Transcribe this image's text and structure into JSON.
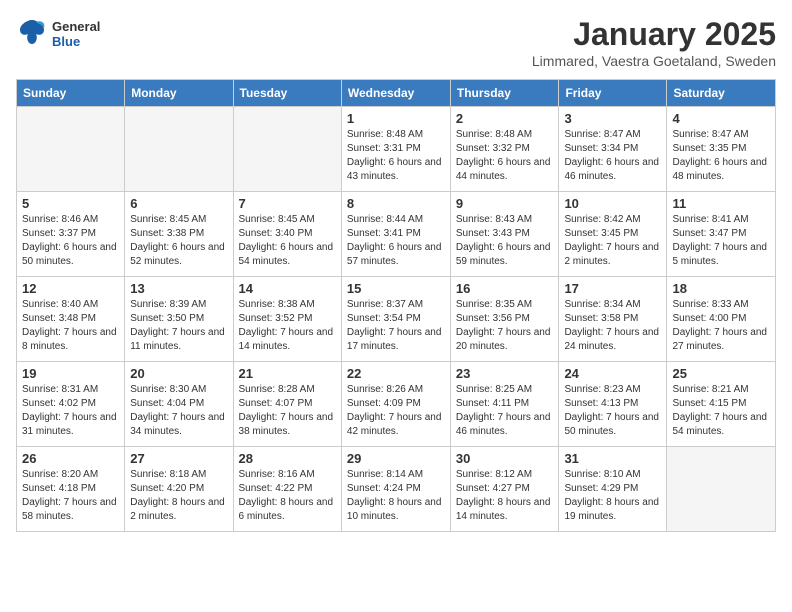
{
  "header": {
    "logo_line1": "General",
    "logo_line2": "Blue",
    "month": "January 2025",
    "location": "Limmared, Vaestra Goetaland, Sweden"
  },
  "weekdays": [
    "Sunday",
    "Monday",
    "Tuesday",
    "Wednesday",
    "Thursday",
    "Friday",
    "Saturday"
  ],
  "weeks": [
    [
      {
        "day": "",
        "sunrise": "",
        "sunset": "",
        "daylight": "",
        "empty": true
      },
      {
        "day": "",
        "sunrise": "",
        "sunset": "",
        "daylight": "",
        "empty": true
      },
      {
        "day": "",
        "sunrise": "",
        "sunset": "",
        "daylight": "",
        "empty": true
      },
      {
        "day": "1",
        "sunrise": "Sunrise: 8:48 AM",
        "sunset": "Sunset: 3:31 PM",
        "daylight": "Daylight: 6 hours and 43 minutes.",
        "empty": false
      },
      {
        "day": "2",
        "sunrise": "Sunrise: 8:48 AM",
        "sunset": "Sunset: 3:32 PM",
        "daylight": "Daylight: 6 hours and 44 minutes.",
        "empty": false
      },
      {
        "day": "3",
        "sunrise": "Sunrise: 8:47 AM",
        "sunset": "Sunset: 3:34 PM",
        "daylight": "Daylight: 6 hours and 46 minutes.",
        "empty": false
      },
      {
        "day": "4",
        "sunrise": "Sunrise: 8:47 AM",
        "sunset": "Sunset: 3:35 PM",
        "daylight": "Daylight: 6 hours and 48 minutes.",
        "empty": false
      }
    ],
    [
      {
        "day": "5",
        "sunrise": "Sunrise: 8:46 AM",
        "sunset": "Sunset: 3:37 PM",
        "daylight": "Daylight: 6 hours and 50 minutes.",
        "empty": false
      },
      {
        "day": "6",
        "sunrise": "Sunrise: 8:45 AM",
        "sunset": "Sunset: 3:38 PM",
        "daylight": "Daylight: 6 hours and 52 minutes.",
        "empty": false
      },
      {
        "day": "7",
        "sunrise": "Sunrise: 8:45 AM",
        "sunset": "Sunset: 3:40 PM",
        "daylight": "Daylight: 6 hours and 54 minutes.",
        "empty": false
      },
      {
        "day": "8",
        "sunrise": "Sunrise: 8:44 AM",
        "sunset": "Sunset: 3:41 PM",
        "daylight": "Daylight: 6 hours and 57 minutes.",
        "empty": false
      },
      {
        "day": "9",
        "sunrise": "Sunrise: 8:43 AM",
        "sunset": "Sunset: 3:43 PM",
        "daylight": "Daylight: 6 hours and 59 minutes.",
        "empty": false
      },
      {
        "day": "10",
        "sunrise": "Sunrise: 8:42 AM",
        "sunset": "Sunset: 3:45 PM",
        "daylight": "Daylight: 7 hours and 2 minutes.",
        "empty": false
      },
      {
        "day": "11",
        "sunrise": "Sunrise: 8:41 AM",
        "sunset": "Sunset: 3:47 PM",
        "daylight": "Daylight: 7 hours and 5 minutes.",
        "empty": false
      }
    ],
    [
      {
        "day": "12",
        "sunrise": "Sunrise: 8:40 AM",
        "sunset": "Sunset: 3:48 PM",
        "daylight": "Daylight: 7 hours and 8 minutes.",
        "empty": false
      },
      {
        "day": "13",
        "sunrise": "Sunrise: 8:39 AM",
        "sunset": "Sunset: 3:50 PM",
        "daylight": "Daylight: 7 hours and 11 minutes.",
        "empty": false
      },
      {
        "day": "14",
        "sunrise": "Sunrise: 8:38 AM",
        "sunset": "Sunset: 3:52 PM",
        "daylight": "Daylight: 7 hours and 14 minutes.",
        "empty": false
      },
      {
        "day": "15",
        "sunrise": "Sunrise: 8:37 AM",
        "sunset": "Sunset: 3:54 PM",
        "daylight": "Daylight: 7 hours and 17 minutes.",
        "empty": false
      },
      {
        "day": "16",
        "sunrise": "Sunrise: 8:35 AM",
        "sunset": "Sunset: 3:56 PM",
        "daylight": "Daylight: 7 hours and 20 minutes.",
        "empty": false
      },
      {
        "day": "17",
        "sunrise": "Sunrise: 8:34 AM",
        "sunset": "Sunset: 3:58 PM",
        "daylight": "Daylight: 7 hours and 24 minutes.",
        "empty": false
      },
      {
        "day": "18",
        "sunrise": "Sunrise: 8:33 AM",
        "sunset": "Sunset: 4:00 PM",
        "daylight": "Daylight: 7 hours and 27 minutes.",
        "empty": false
      }
    ],
    [
      {
        "day": "19",
        "sunrise": "Sunrise: 8:31 AM",
        "sunset": "Sunset: 4:02 PM",
        "daylight": "Daylight: 7 hours and 31 minutes.",
        "empty": false
      },
      {
        "day": "20",
        "sunrise": "Sunrise: 8:30 AM",
        "sunset": "Sunset: 4:04 PM",
        "daylight": "Daylight: 7 hours and 34 minutes.",
        "empty": false
      },
      {
        "day": "21",
        "sunrise": "Sunrise: 8:28 AM",
        "sunset": "Sunset: 4:07 PM",
        "daylight": "Daylight: 7 hours and 38 minutes.",
        "empty": false
      },
      {
        "day": "22",
        "sunrise": "Sunrise: 8:26 AM",
        "sunset": "Sunset: 4:09 PM",
        "daylight": "Daylight: 7 hours and 42 minutes.",
        "empty": false
      },
      {
        "day": "23",
        "sunrise": "Sunrise: 8:25 AM",
        "sunset": "Sunset: 4:11 PM",
        "daylight": "Daylight: 7 hours and 46 minutes.",
        "empty": false
      },
      {
        "day": "24",
        "sunrise": "Sunrise: 8:23 AM",
        "sunset": "Sunset: 4:13 PM",
        "daylight": "Daylight: 7 hours and 50 minutes.",
        "empty": false
      },
      {
        "day": "25",
        "sunrise": "Sunrise: 8:21 AM",
        "sunset": "Sunset: 4:15 PM",
        "daylight": "Daylight: 7 hours and 54 minutes.",
        "empty": false
      }
    ],
    [
      {
        "day": "26",
        "sunrise": "Sunrise: 8:20 AM",
        "sunset": "Sunset: 4:18 PM",
        "daylight": "Daylight: 7 hours and 58 minutes.",
        "empty": false
      },
      {
        "day": "27",
        "sunrise": "Sunrise: 8:18 AM",
        "sunset": "Sunset: 4:20 PM",
        "daylight": "Daylight: 8 hours and 2 minutes.",
        "empty": false
      },
      {
        "day": "28",
        "sunrise": "Sunrise: 8:16 AM",
        "sunset": "Sunset: 4:22 PM",
        "daylight": "Daylight: 8 hours and 6 minutes.",
        "empty": false
      },
      {
        "day": "29",
        "sunrise": "Sunrise: 8:14 AM",
        "sunset": "Sunset: 4:24 PM",
        "daylight": "Daylight: 8 hours and 10 minutes.",
        "empty": false
      },
      {
        "day": "30",
        "sunrise": "Sunrise: 8:12 AM",
        "sunset": "Sunset: 4:27 PM",
        "daylight": "Daylight: 8 hours and 14 minutes.",
        "empty": false
      },
      {
        "day": "31",
        "sunrise": "Sunrise: 8:10 AM",
        "sunset": "Sunset: 4:29 PM",
        "daylight": "Daylight: 8 hours and 19 minutes.",
        "empty": false
      },
      {
        "day": "",
        "sunrise": "",
        "sunset": "",
        "daylight": "",
        "empty": true
      }
    ]
  ]
}
